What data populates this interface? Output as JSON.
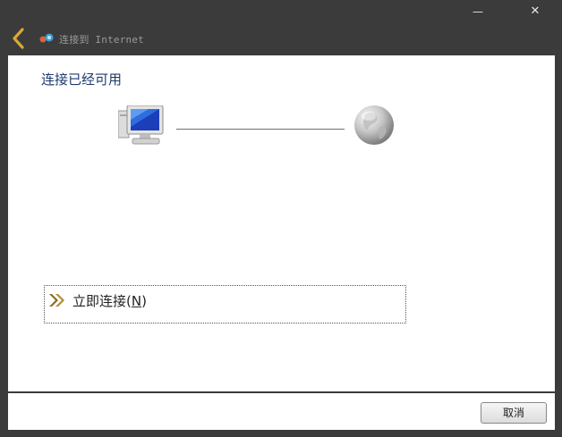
{
  "window": {
    "minimize_glyph": "—",
    "close_glyph": "✕",
    "title": "连接到 Internet"
  },
  "page": {
    "heading": "连接已经可用"
  },
  "diagram": {
    "left_icon": "computer-icon",
    "right_icon": "globe-icon"
  },
  "option": {
    "label_prefix": "立即连接(",
    "label_accel": "N",
    "label_suffix": ")"
  },
  "footer": {
    "cancel_label": "取消"
  },
  "colors": {
    "frame": "#3b3b3b",
    "heading": "#1e3b6e",
    "back_arrow": "#d8a837"
  }
}
